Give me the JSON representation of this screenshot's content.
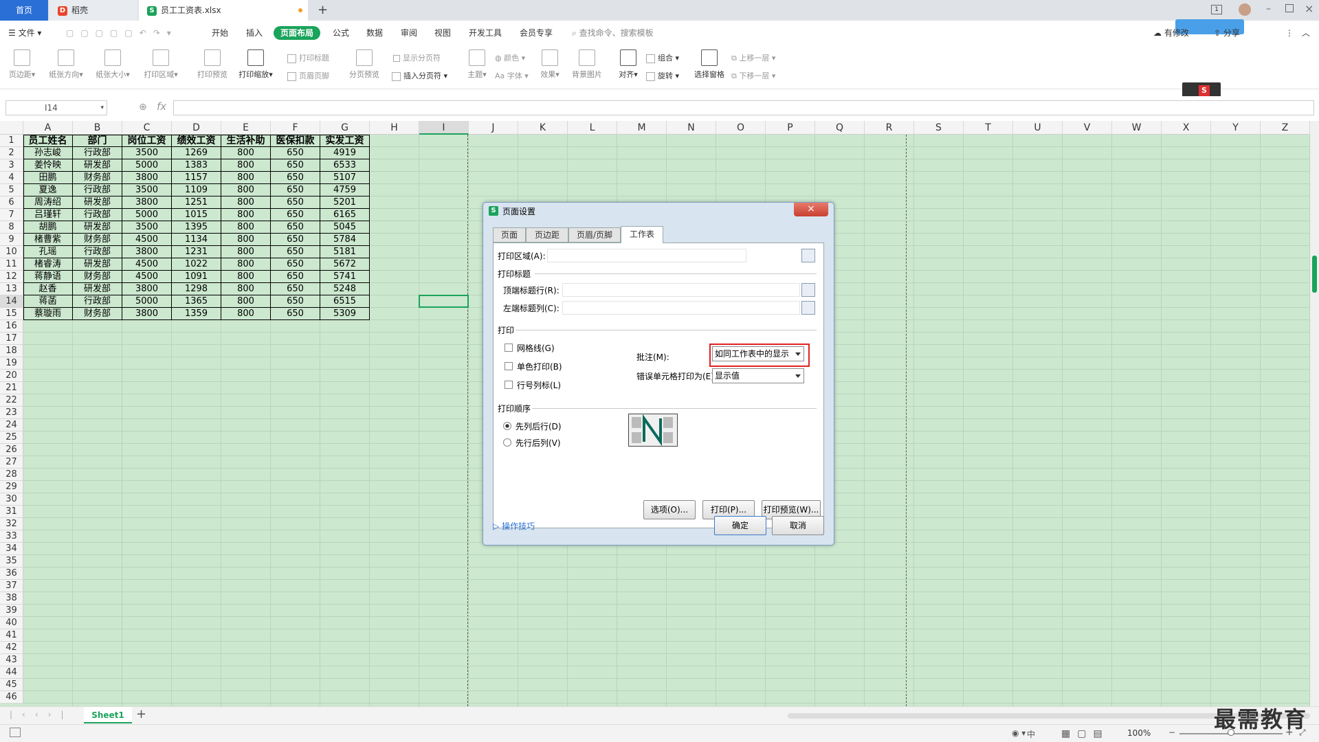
{
  "tabs": [
    {
      "label": "首页"
    },
    {
      "label": "稻壳"
    },
    {
      "label": "员工工资表.xlsx"
    }
  ],
  "menu": {
    "file": "文件",
    "items": [
      "开始",
      "插入",
      "页面布局",
      "公式",
      "数据",
      "审阅",
      "视图",
      "开发工具",
      "会员专享"
    ],
    "search": "查找命令、搜索模板",
    "share": "分享",
    "sync": "有修改"
  },
  "ribbon": {
    "big": [
      "页边距",
      "纸张方向",
      "纸张大小",
      "打印区域",
      "打印预览",
      "打印缩放",
      "分页预览",
      "主题",
      "效果",
      "背景图片",
      "对齐",
      "旋转",
      "选择窗格"
    ],
    "small": {
      "print_title": "打印标题",
      "header_footer": "页眉页脚",
      "show_breaks": "显示分页符",
      "insert_break": "插入分页符",
      "color": "颜色",
      "font": "字体",
      "group": "组合",
      "bring_up": "上移一层",
      "send_down": "下移一层"
    }
  },
  "formula": {
    "cell_ref": "I14",
    "fx": "fx"
  },
  "columns": [
    "A",
    "B",
    "C",
    "D",
    "E",
    "F",
    "G",
    "H",
    "I",
    "J",
    "K",
    "L",
    "M",
    "N",
    "O",
    "P",
    "Q",
    "R",
    "S",
    "T",
    "U",
    "V",
    "W",
    "X",
    "Y",
    "Z"
  ],
  "table": {
    "headers": [
      "员工姓名",
      "部门",
      "岗位工资",
      "绩效工资",
      "生活补助",
      "医保扣款",
      "实发工资"
    ],
    "rows": [
      [
        "孙志峻",
        "行政部",
        "3500",
        "1269",
        "800",
        "650",
        "4919"
      ],
      [
        "姜怜映",
        "研发部",
        "5000",
        "1383",
        "800",
        "650",
        "6533"
      ],
      [
        "田鹏",
        "财务部",
        "3800",
        "1157",
        "800",
        "650",
        "5107"
      ],
      [
        "夏逸",
        "行政部",
        "3500",
        "1109",
        "800",
        "650",
        "4759"
      ],
      [
        "周涛绍",
        "研发部",
        "3800",
        "1251",
        "800",
        "650",
        "5201"
      ],
      [
        "吕瑾轩",
        "行政部",
        "5000",
        "1015",
        "800",
        "650",
        "6165"
      ],
      [
        "胡鹏",
        "研发部",
        "3500",
        "1395",
        "800",
        "650",
        "5045"
      ],
      [
        "楮曹紫",
        "财务部",
        "4500",
        "1134",
        "800",
        "650",
        "5784"
      ],
      [
        "孔瑶",
        "行政部",
        "3800",
        "1231",
        "800",
        "650",
        "5181"
      ],
      [
        "楮睿涛",
        "研发部",
        "4500",
        "1022",
        "800",
        "650",
        "5672"
      ],
      [
        "蒋静语",
        "财务部",
        "4500",
        "1091",
        "800",
        "650",
        "5741"
      ],
      [
        "赵香",
        "研发部",
        "3800",
        "1298",
        "800",
        "650",
        "5248"
      ],
      [
        "蒋菡",
        "行政部",
        "5000",
        "1365",
        "800",
        "650",
        "6515"
      ],
      [
        "蔡璇雨",
        "财务部",
        "3800",
        "1359",
        "800",
        "650",
        "5309"
      ]
    ]
  },
  "dialog": {
    "title": "页面设置",
    "tabs": [
      "页面",
      "页边距",
      "页眉/页脚",
      "工作表"
    ],
    "print_area": "打印区域(A):",
    "print_titles": "打印标题",
    "top_rows": "顶端标题行(R):",
    "left_cols": "左端标题列(C):",
    "print": "打印",
    "gridlines": "网格线(G)",
    "mono": "单色打印(B)",
    "rowcol": "行号列标(L)",
    "comments_label": "批注(M):",
    "comments_value": "如同工作表中的显示",
    "errors_label": "错误单元格打印为(E):",
    "errors_value": "显示值",
    "order": "打印顺序",
    "down_then_over": "先列后行(D)",
    "over_then_down": "先行后列(V)",
    "options": "选项(O)...",
    "print_btn": "打印(P)...",
    "preview_btn": "打印预览(W)...",
    "tips": "操作技巧",
    "ok": "确定",
    "cancel": "取消"
  },
  "sheet": {
    "name": "Sheet1"
  },
  "status": {
    "zoom": "100%",
    "mode": "中"
  },
  "watermark": "最需教育",
  "colors": {
    "accent": "#1aa35a",
    "grid_bg": "#cce8cf",
    "highlight": "#e02020",
    "tab_blue": "#2a6fd6"
  }
}
